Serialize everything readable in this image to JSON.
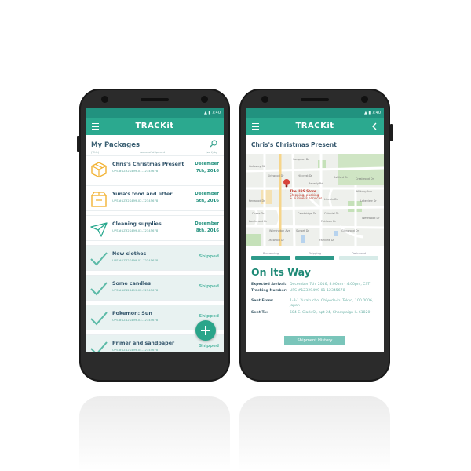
{
  "app": {
    "title": "TRACKit"
  },
  "status_bar": {
    "time": "7:40"
  },
  "list_screen": {
    "heading": "My Packages",
    "col_left": "(Title)",
    "col_mid": "name of shipment",
    "col_right": "(sort) by",
    "packages": [
      {
        "name": "Chris's Christmas Present",
        "tracking": "UPS #1Z32S499-01-12345678",
        "date_line1": "December",
        "date_line2": "7th, 2016",
        "icon": "box-icon"
      },
      {
        "name": "Yuna's food and litter",
        "tracking": "UPS #1Z32S499-02-12345678",
        "date_line1": "December",
        "date_line2": "5th, 2016",
        "icon": "box-icon"
      },
      {
        "name": "Cleaning supplies",
        "tracking": "UPS #1Z32S499-03-12345678",
        "date_line1": "December",
        "date_line2": "8th, 2016",
        "icon": "paper-plane-icon"
      },
      {
        "name": "New clothes",
        "tracking": "UPS #1Z42S499-01-12345678",
        "status": "Shipped",
        "icon": "checkmark-icon"
      },
      {
        "name": "Some candles",
        "tracking": "UPS #1Z42S499-02-12345678",
        "status": "Shipped",
        "icon": "checkmark-icon"
      },
      {
        "name": "Pokemon: Sun",
        "tracking": "UPS #1Z42S499-03-12345678",
        "status": "Shipped",
        "icon": "checkmark-icon"
      },
      {
        "name": "Primer and sandpaper",
        "tracking": "UPS #1Z42S499-04-12345678",
        "status": "Shipped",
        "icon": "checkmark-icon"
      }
    ]
  },
  "detail_screen": {
    "title": "Chris's Christmas Present",
    "map": {
      "streets": [
        "Sampson Dr",
        "Galloway St",
        "Kirkwood Dr",
        "Hillcrest Dr",
        "Wildoby Ave",
        "Beverly Rd",
        "Lincoln Dr",
        "Ashford Dr",
        "Lakeview Dr",
        "Chase Dr",
        "Cambridge Dr",
        "Colonial Dr",
        "Westwood Dr",
        "Larchmont Dr",
        "Wilmington Ave",
        "Fairlawn Dr",
        "Crestwood Dr",
        "Kenwood Dr",
        "Sunset Dr",
        "Glenwood Dr",
        "Oakwood Dr",
        "Fairview Dr"
      ],
      "place_name": "The UPS Store",
      "place_desc1": "Shipping, packing",
      "place_desc2": "& business services"
    },
    "progress": {
      "steps": [
        "Processing",
        "Shipping",
        "Delivered"
      ],
      "completed": 2
    },
    "status": "On Its Way",
    "expected_label": "Expected Arrival:",
    "expected_value": "December 7th, 2016, 8:00am - 4:00pm, CST",
    "tracking_label": "Tracking Number:",
    "tracking_value": "UPS #1Z32S499-01-12345678",
    "sent_from_label": "Sent From:",
    "sent_from_value": "1-8-1 Yurakucho, Chiyoda-ku Tokyo, 100 0006, Japan",
    "sent_to_label": "Sent To:",
    "sent_to_value": "504 E. Clark St, apt 24, Champaign IL 61820",
    "history_button": "Shipment History"
  },
  "colors": {
    "primary": "#2ba98f",
    "primary_dark": "#21927f",
    "accent_box": "#f2b233"
  }
}
